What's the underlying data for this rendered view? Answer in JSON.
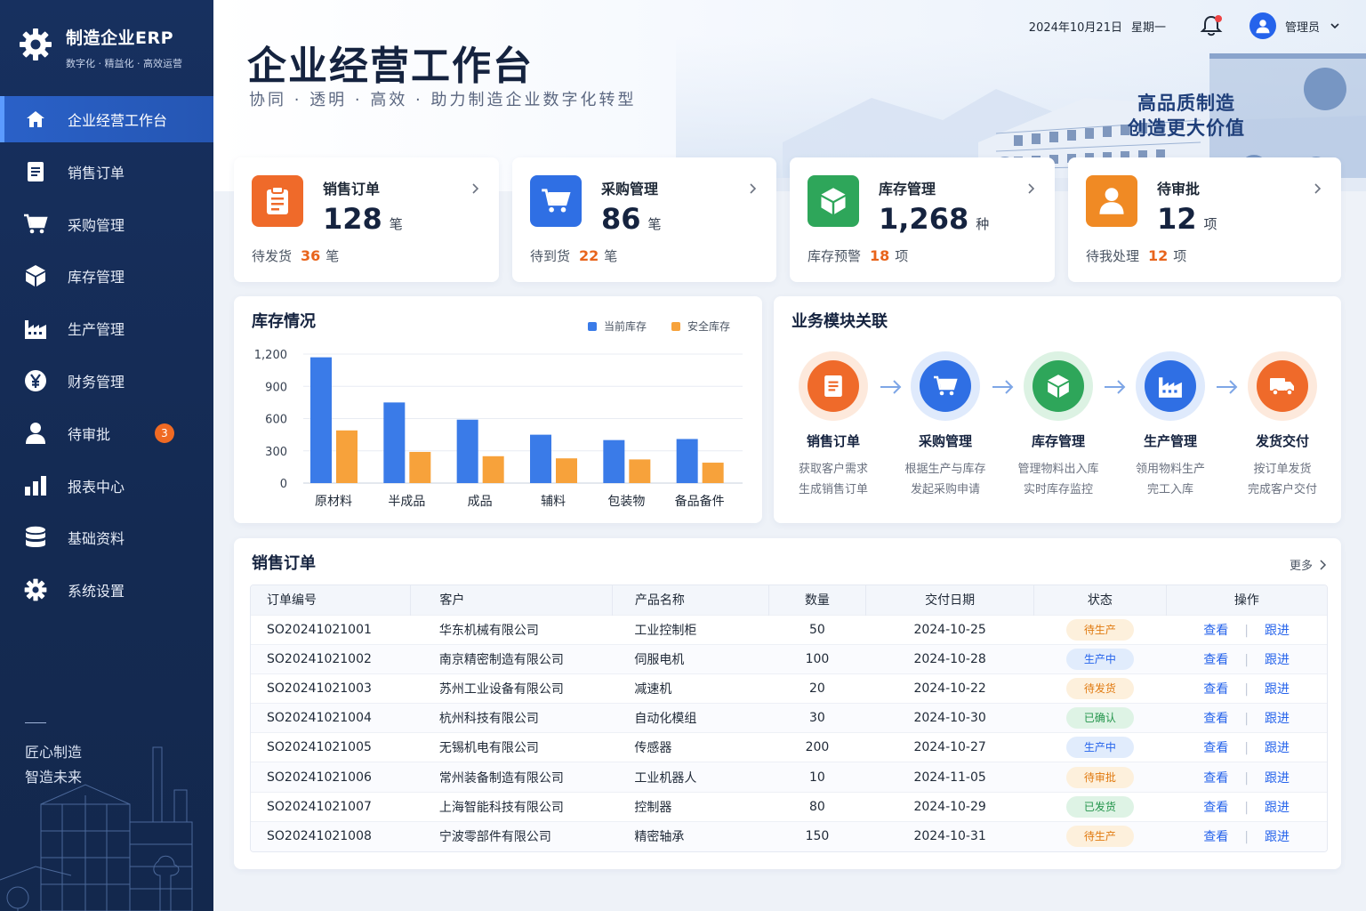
{
  "brand": {
    "title": "制造企业ERP",
    "subtitle": "数字化 · 精益化 · 高效运营"
  },
  "sidebar": {
    "items": [
      {
        "label": "企业经营工作台",
        "icon": "home-icon",
        "active": true
      },
      {
        "label": "销售订单",
        "icon": "document-icon"
      },
      {
        "label": "采购管理",
        "icon": "cart-icon"
      },
      {
        "label": "库存管理",
        "icon": "box-icon"
      },
      {
        "label": "生产管理",
        "icon": "factory-icon"
      },
      {
        "label": "财务管理",
        "icon": "yen-icon"
      },
      {
        "label": "待审批",
        "icon": "user-icon",
        "badge": "3"
      },
      {
        "label": "报表中心",
        "icon": "bar-chart-icon"
      },
      {
        "label": "基础资料",
        "icon": "database-icon"
      },
      {
        "label": "系统设置",
        "icon": "gear-icon"
      }
    ],
    "slogan": [
      "匠心制造",
      "智造未来"
    ]
  },
  "header": {
    "title": "企业经营工作台",
    "subtitle": "协同 · 透明 · 高效 · 助力制造企业数字化转型",
    "date": "2024年10月21日",
    "weekday": "星期一",
    "user": "管理员",
    "hero_slogan": [
      "高品质制造",
      "创造更大价值"
    ]
  },
  "stats": [
    {
      "title": "销售订单",
      "value": "128",
      "unit": "笔",
      "foot_label": "待发货",
      "foot_value": "36",
      "foot_unit": "笔",
      "color": "#ef6a2a",
      "icon": "clipboard-icon"
    },
    {
      "title": "采购管理",
      "value": "86",
      "unit": "笔",
      "foot_label": "待到货",
      "foot_value": "22",
      "foot_unit": "笔",
      "color": "#2f6fe4",
      "icon": "cart-icon"
    },
    {
      "title": "库存管理",
      "value": "1,268",
      "unit": "种",
      "foot_label": "库存预警",
      "foot_value": "18",
      "foot_unit": "项",
      "color": "#2ea65a",
      "icon": "box-icon"
    },
    {
      "title": "待审批",
      "value": "12",
      "unit": "项",
      "foot_label": "待我处理",
      "foot_value": "12",
      "foot_unit": "项",
      "color": "#f08a24",
      "icon": "user-icon"
    }
  ],
  "inventory": {
    "title": "库存情况",
    "chart_data": {
      "type": "bar",
      "categories": [
        "原材料",
        "半成品",
        "成品",
        "辅料",
        "包装物",
        "备品备件"
      ],
      "series": [
        {
          "name": "当前库存",
          "values": [
            1170,
            750,
            590,
            450,
            400,
            410
          ],
          "color": "#3a7be8"
        },
        {
          "name": "安全库存",
          "values": [
            490,
            290,
            250,
            230,
            220,
            190
          ],
          "color": "#f7a23b"
        }
      ],
      "yticks": [
        "0",
        "300",
        "600",
        "900",
        "1,200"
      ],
      "ylim": [
        0,
        1200
      ],
      "legend": "top-right",
      "grid": true
    }
  },
  "flow": {
    "title": "业务模块关联",
    "nodes": [
      {
        "name": "销售订单",
        "desc1": "获取客户需求",
        "desc2": "生成销售订单",
        "color": "#ef6a2a",
        "ring": "#fde9dc",
        "icon": "document-icon"
      },
      {
        "name": "采购管理",
        "desc1": "根据生产与库存",
        "desc2": "发起采购申请",
        "color": "#2f6fe4",
        "ring": "#dfeafc",
        "icon": "cart-icon"
      },
      {
        "name": "库存管理",
        "desc1": "管理物料出入库",
        "desc2": "实时库存监控",
        "color": "#2ea65a",
        "ring": "#dcf2e3",
        "icon": "box-icon"
      },
      {
        "name": "生产管理",
        "desc1": "领用物料生产",
        "desc2": "完工入库",
        "color": "#2f6fe4",
        "ring": "#dfeafc",
        "icon": "factory-icon"
      },
      {
        "name": "发货交付",
        "desc1": "按订单发货",
        "desc2": "完成客户交付",
        "color": "#ef6a2a",
        "ring": "#fde9dc",
        "icon": "truck-icon"
      }
    ]
  },
  "orders": {
    "title": "销售订单",
    "more": "更多",
    "columns": [
      "订单编号",
      "客户",
      "产品名称",
      "数量",
      "交付日期",
      "状态",
      "操作"
    ],
    "view_label": "查看",
    "follow_label": "跟进",
    "rows": [
      {
        "id": "SO20241021001",
        "customer": "华东机械有限公司",
        "product": "工业控制柜",
        "qty": "50",
        "date": "2024-10-25",
        "status": "待生产",
        "status_type": "orange"
      },
      {
        "id": "SO20241021002",
        "customer": "南京精密制造有限公司",
        "product": "伺服电机",
        "qty": "100",
        "date": "2024-10-28",
        "status": "生产中",
        "status_type": "blue"
      },
      {
        "id": "SO20241021003",
        "customer": "苏州工业设备有限公司",
        "product": "减速机",
        "qty": "20",
        "date": "2024-10-22",
        "status": "待发货",
        "status_type": "orange"
      },
      {
        "id": "SO20241021004",
        "customer": "杭州科技有限公司",
        "product": "自动化模组",
        "qty": "30",
        "date": "2024-10-30",
        "status": "已确认",
        "status_type": "green"
      },
      {
        "id": "SO20241021005",
        "customer": "无锡机电有限公司",
        "product": "传感器",
        "qty": "200",
        "date": "2024-10-27",
        "status": "生产中",
        "status_type": "blue"
      },
      {
        "id": "SO20241021006",
        "customer": "常州装备制造有限公司",
        "product": "工业机器人",
        "qty": "10",
        "date": "2024-11-05",
        "status": "待审批",
        "status_type": "orange"
      },
      {
        "id": "SO20241021007",
        "customer": "上海智能科技有限公司",
        "product": "控制器",
        "qty": "80",
        "date": "2024-10-29",
        "status": "已发货",
        "status_type": "green"
      },
      {
        "id": "SO20241021008",
        "customer": "宁波零部件有限公司",
        "product": "精密轴承",
        "qty": "150",
        "date": "2024-10-31",
        "status": "待生产",
        "status_type": "orange"
      }
    ]
  }
}
